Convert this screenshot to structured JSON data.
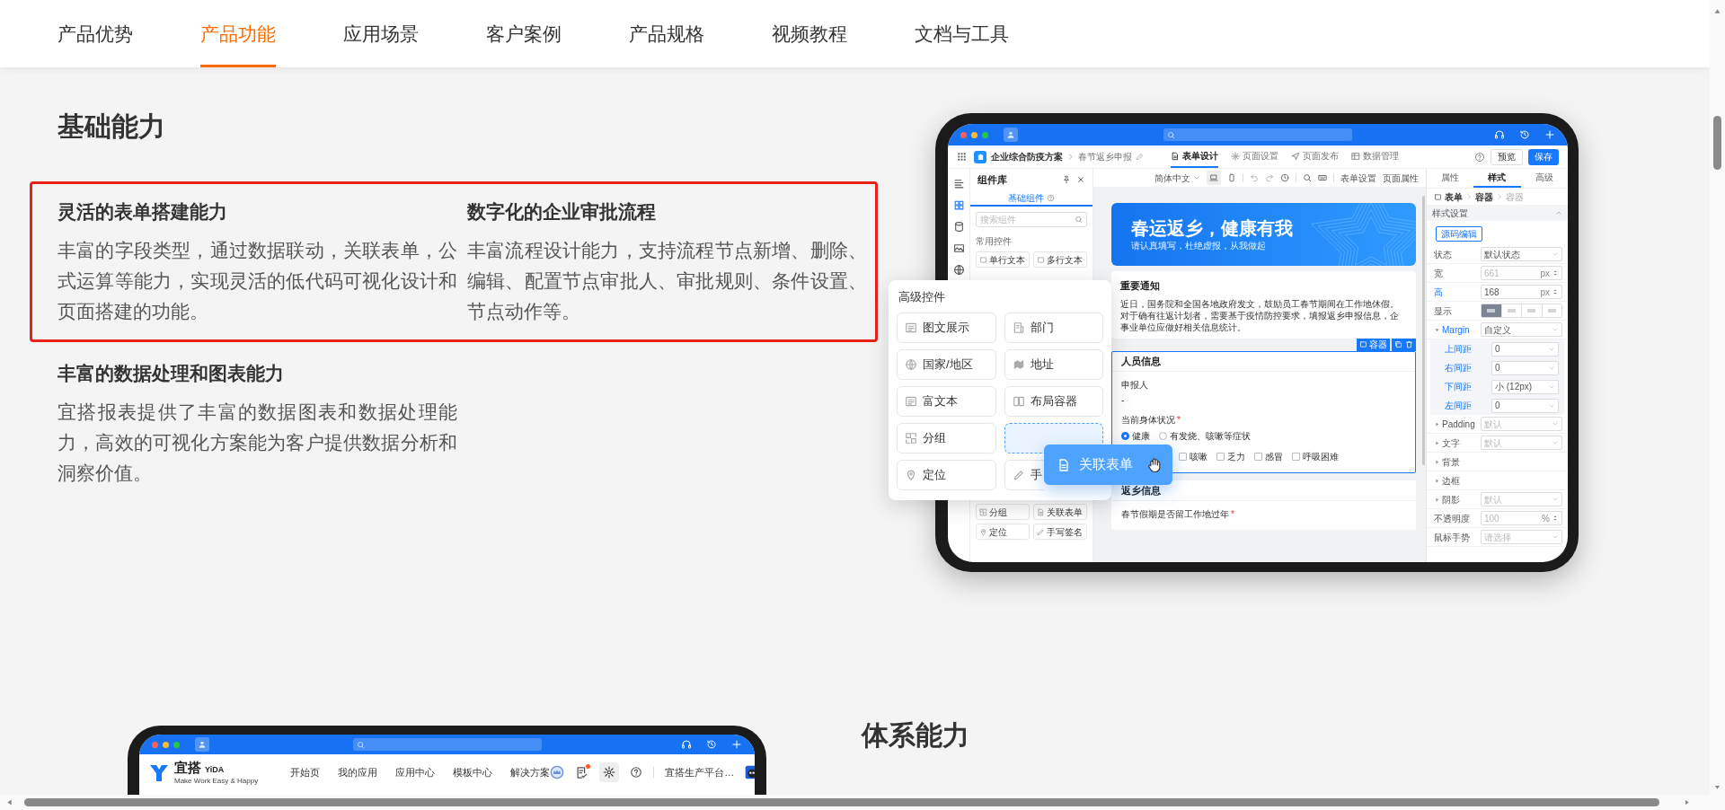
{
  "nav": {
    "tabs": [
      {
        "label": "产品优势",
        "selected": false
      },
      {
        "label": "产品功能",
        "selected": true
      },
      {
        "label": "应用场景",
        "selected": false
      },
      {
        "label": "客户案例",
        "selected": false
      },
      {
        "label": "产品规格",
        "selected": false
      },
      {
        "label": "视频教程",
        "selected": false
      },
      {
        "label": "文档与工具",
        "selected": false
      }
    ]
  },
  "basic_capabilities": {
    "title": "基础能力",
    "features": [
      {
        "title": "灵活的表单搭建能力",
        "body": "丰富的字段类型，通过数据联动，关联表单，公式运算等能力，实现灵活的低代码可视化设计和页面搭建的功能。",
        "highlighted": true
      },
      {
        "title": "数字化的企业审批流程",
        "body": "丰富流程设计能力，支持流程节点新增、删除、编辑、配置节点审批人、审批规则、条件设置、节点动作等。",
        "highlighted": true
      },
      {
        "title": "丰富的数据处理和图表能力",
        "body": "宜搭报表提供了丰富的数据图表和数据处理能力，高效的可视化方案能为客户提供数据分析和洞察价值。",
        "highlighted": false
      }
    ]
  },
  "form_designer": {
    "breadcrumb": [
      "企业综合防疫方案",
      "春节返乡申报"
    ],
    "tabs": [
      {
        "label": "表单设计",
        "selected": true
      },
      {
        "label": "页面设置",
        "selected": false
      },
      {
        "label": "页面发布",
        "selected": false
      },
      {
        "label": "数据管理",
        "selected": false
      }
    ],
    "preview_button": "预览",
    "save_button": "保存",
    "component_library": {
      "title": "组件库",
      "tab": "基础组件",
      "search_placeholder": "搜索组件",
      "group": "常用控件",
      "top_items": [
        "单行文本",
        "多行文本"
      ],
      "bottom_items": [
        "分组",
        "关联表单",
        "定位",
        "手写签名"
      ]
    },
    "toolbar": {
      "language": "简体中文",
      "links": [
        "表单设置",
        "页面属性"
      ]
    },
    "banner": {
      "title": "春运返乡，健康有我",
      "subtitle": "请认真填写，杜绝虚报，从我做起"
    },
    "notice": {
      "title": "重要通知",
      "body": "近日，国务院和全国各地政府发文，鼓励员工春节期间在工作地休假。对于确有往返计划者，需要基于疫情防控要求，填报返乡申报信息，企事业单位应做好相关信息统计。"
    },
    "selection_tag": "容器",
    "sections": [
      {
        "title": "人员信息",
        "selected": true,
        "fields": [
          {
            "kind": "text",
            "label": "申报人",
            "value": "-"
          },
          {
            "kind": "radio",
            "label": "当前身体状况",
            "required_mark": "*",
            "options": [
              {
                "label": "健康",
                "checked": true
              },
              {
                "label": "有发烧、咳嗽等症状",
                "checked": false
              }
            ]
          },
          {
            "kind": "checkbox",
            "options": [
              {
                "label": "咳嗽",
                "checked": false
              },
              {
                "label": "乏力",
                "checked": false
              },
              {
                "label": "感冒",
                "checked": false
              },
              {
                "label": "呼吸困难",
                "checked": false
              }
            ]
          }
        ]
      },
      {
        "title": "返乡信息",
        "selected": false,
        "fields": [
          {
            "kind": "radio",
            "label": "春节假期是否留工作地过年",
            "required_mark": "*"
          }
        ]
      }
    ],
    "properties": {
      "tabs": [
        {
          "label": "属性",
          "selected": false
        },
        {
          "label": "样式",
          "selected": true
        },
        {
          "label": "高级",
          "selected": false
        }
      ],
      "breadcrumb": [
        "表单",
        "容器",
        "容器"
      ],
      "section": "样式设置",
      "source_button": "源码编辑",
      "rows": [
        {
          "kind": "select",
          "label": "状态",
          "value": "默认状态",
          "modified": false
        },
        {
          "kind": "number",
          "label": "宽",
          "placeholder": "661",
          "unit": "px",
          "modified": false
        },
        {
          "kind": "number",
          "label": "高",
          "value": "168",
          "unit": "px",
          "modified": true
        },
        {
          "kind": "segmented",
          "label": "显示",
          "modified": false,
          "options": [
            {
              "selected": true
            },
            {
              "selected": false
            },
            {
              "selected": false
            },
            {
              "selected": false
            }
          ]
        },
        {
          "kind": "group",
          "label": "Margin",
          "value": "自定义",
          "expanded": true,
          "modified": true,
          "children": [
            {
              "kind": "select",
              "label": "上间距",
              "value": "0",
              "modified": true
            },
            {
              "kind": "select",
              "label": "右间距",
              "value": "0",
              "modified": true
            },
            {
              "kind": "select",
              "label": "下间距",
              "value": "小 (12px)",
              "modified": true
            },
            {
              "kind": "select",
              "label": "左间距",
              "value": "0",
              "modified": true
            }
          ]
        },
        {
          "kind": "group",
          "label": "Padding",
          "placeholder": "默认",
          "expanded": false,
          "modified": false
        },
        {
          "kind": "group",
          "label": "文字",
          "placeholder": "默认",
          "expanded": false,
          "modified": false
        },
        {
          "kind": "group",
          "label": "背景",
          "expanded": false,
          "modified": false
        },
        {
          "kind": "group",
          "label": "边框",
          "expanded": false,
          "modified": false
        },
        {
          "kind": "group",
          "label": "阴影",
          "placeholder": "默认",
          "expanded": false,
          "modified": false
        },
        {
          "kind": "number",
          "label": "不透明度",
          "placeholder": "100",
          "unit": "%",
          "modified": false
        },
        {
          "kind": "select",
          "label": "鼠标手势",
          "placeholder": "请选择",
          "modified": false
        }
      ]
    }
  },
  "widget_popup": {
    "title": "高级控件",
    "items": [
      {
        "label": "图文展示",
        "dragging": false
      },
      {
        "label": "部门",
        "dragging": false
      },
      {
        "label": "国家/地区",
        "dragging": false
      },
      {
        "label": "地址",
        "dragging": false
      },
      {
        "label": "富文本",
        "dragging": false
      },
      {
        "label": "布局容器",
        "dragging": false
      },
      {
        "label": "分组",
        "dragging": false
      },
      {
        "dragging": true
      },
      {
        "label": "定位",
        "dragging": false
      },
      {
        "label": "手",
        "dragging": false
      }
    ],
    "drag_chip": "关联表单"
  },
  "system_capabilities": {
    "title": "体系能力",
    "app_window": {
      "brand": "宜搭",
      "brand_latin": "YiDA",
      "slogan": "Make Work Easy & Happy",
      "menu": [
        "开始页",
        "我的应用",
        "应用中心",
        "模板中心",
        "解决方案"
      ],
      "notification_badge": true,
      "account": "宜搭生产平台…"
    }
  }
}
